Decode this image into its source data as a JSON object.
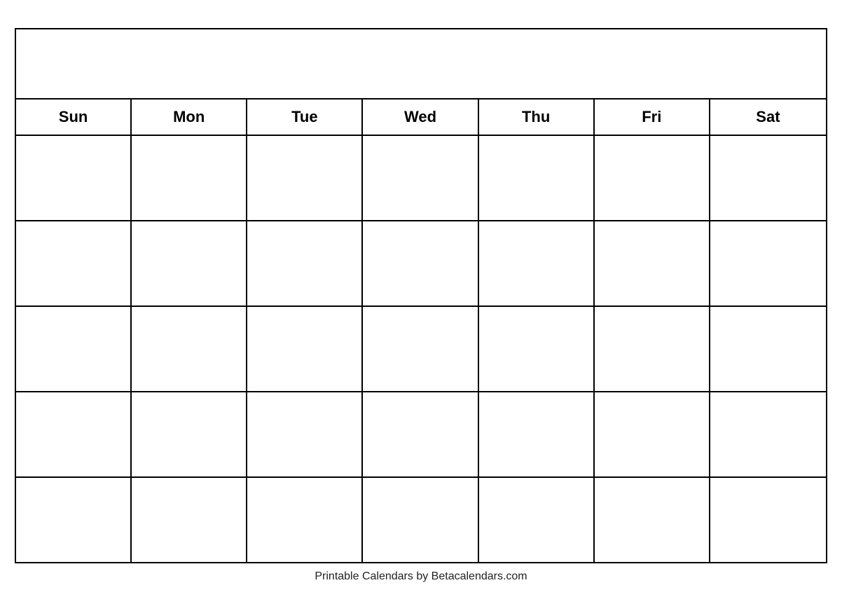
{
  "calendar": {
    "title": "",
    "days": [
      "Sun",
      "Mon",
      "Tue",
      "Wed",
      "Thu",
      "Fri",
      "Sat"
    ],
    "weeks": [
      [
        "",
        "",
        "",
        "",
        "",
        "",
        ""
      ],
      [
        "",
        "",
        "",
        "",
        "",
        "",
        ""
      ],
      [
        "",
        "",
        "",
        "",
        "",
        "",
        ""
      ],
      [
        "",
        "",
        "",
        "",
        "",
        "",
        ""
      ],
      [
        "",
        "",
        "",
        "",
        "",
        "",
        ""
      ]
    ],
    "footer": "Printable Calendars by Betacalendars.com"
  }
}
